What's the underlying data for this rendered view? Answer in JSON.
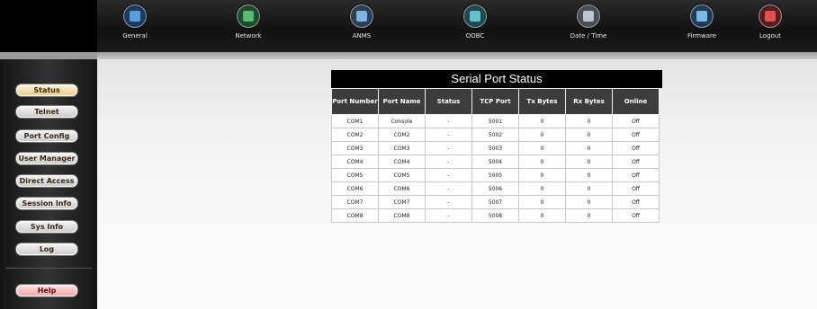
{
  "nav": {
    "items": [
      {
        "label": "General",
        "icon": "general-icon",
        "color": "#5aa0d8"
      },
      {
        "label": "Network",
        "icon": "network-icon",
        "color": "#5cb870"
      },
      {
        "label": "ANMS",
        "icon": "anms-icon",
        "color": "#7fb4e0"
      },
      {
        "label": "OOBC",
        "icon": "oobc-icon",
        "color": "#64c2c9"
      },
      {
        "label": "Date / Time",
        "icon": "date-time-icon",
        "color": "#b9c6d1"
      },
      {
        "label": "Firmware",
        "icon": "firmware-icon",
        "color": "#7ab8e6"
      },
      {
        "label": "Logout",
        "icon": "logout-icon",
        "color": "#e05050"
      }
    ]
  },
  "sidebar": {
    "items": [
      {
        "label": "Status"
      },
      {
        "label": "Telnet"
      },
      {
        "label": "Port Config"
      },
      {
        "label": "User Manager"
      },
      {
        "label": "Direct Access"
      },
      {
        "label": "Session Info"
      },
      {
        "label": "Sys Info"
      },
      {
        "label": "Log"
      },
      {
        "label": "Help"
      }
    ]
  },
  "status_table": {
    "title": "Serial Port Status",
    "columns": [
      "Port Number",
      "Port Name",
      "Status",
      "TCP Port",
      "Tx Bytes",
      "Rx Bytes",
      "Online"
    ],
    "rows": [
      [
        "COM1",
        "Console",
        "-",
        "5001",
        "0",
        "0",
        "Off"
      ],
      [
        "COM2",
        "COM2",
        "-",
        "5002",
        "0",
        "0",
        "Off"
      ],
      [
        "COM3",
        "COM3",
        "-",
        "5003",
        "0",
        "0",
        "Off"
      ],
      [
        "COM4",
        "COM4",
        "-",
        "5004",
        "0",
        "0",
        "Off"
      ],
      [
        "COM5",
        "COM5",
        "-",
        "5005",
        "0",
        "0",
        "Off"
      ],
      [
        "COM6",
        "COM6",
        "-",
        "5006",
        "0",
        "0",
        "Off"
      ],
      [
        "COM7",
        "COM7",
        "-",
        "5007",
        "0",
        "0",
        "Off"
      ],
      [
        "COM8",
        "COM8",
        "-",
        "5008",
        "0",
        "0",
        "Off"
      ]
    ]
  }
}
